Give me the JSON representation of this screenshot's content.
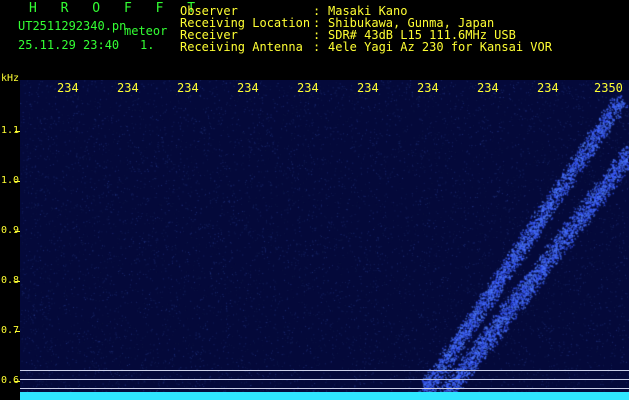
{
  "header": {
    "app_title": "H R O F F T",
    "file_name": "UT2511292340.pn",
    "mode": "meteor",
    "datetime": "25.11.29 23:40",
    "page_indicator": "1.",
    "metadata": [
      {
        "label": "Observer",
        "value": "Masaki Kano"
      },
      {
        "label": "Receiving Location",
        "value": "Shibukawa, Gunma, Japan"
      },
      {
        "label": "Receiver",
        "value": "SDR# 43dB L15 111.6MHz USB"
      },
      {
        "label": "Receiving Antenna",
        "value": "4ele Yagi Az 230 for Kansai VOR"
      }
    ],
    "separator": ":"
  },
  "axes": {
    "y_unit": "kHz",
    "y_ticks": [
      "1.1",
      "1.0",
      "0.9",
      "0.8",
      "0.7",
      "0.6"
    ],
    "x_ticks": [
      "234",
      "234",
      "234",
      "234",
      "234",
      "234",
      "234",
      "234",
      "234",
      "2350"
    ]
  },
  "colors": {
    "header_green": "#33ff33",
    "label_yellow": "#ffff33",
    "background": "#04093a",
    "signal": "#4f7bff",
    "baseline_cyan": "#2fe6ff"
  }
}
